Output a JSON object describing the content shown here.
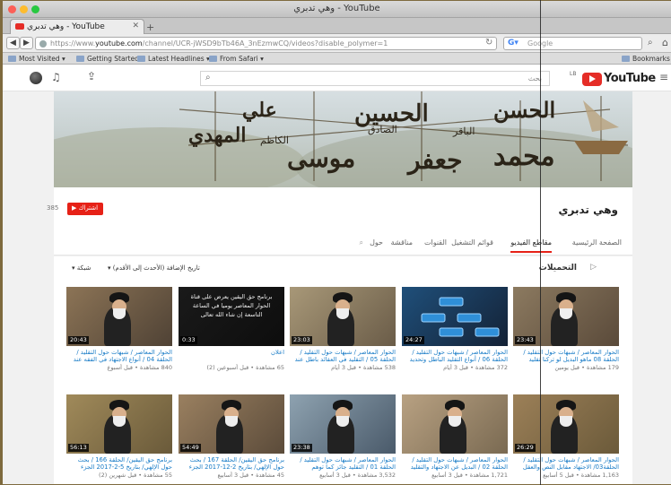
{
  "window": {
    "title": "وهي تدبري - YouTube"
  },
  "tab": {
    "title": "وهي تدبري - YouTube"
  },
  "url": {
    "prefix": "https://www.",
    "domain": "youtube.com",
    "path": "/channel/UCR-jWSD9bTb46A_3nEzmwCQ/videos?disable_polymer=1"
  },
  "search_engine": {
    "placeholder": "Google"
  },
  "bookmarks": {
    "items": [
      "Most Visited",
      "Getting Started",
      "Latest Headlines",
      "From Safari"
    ],
    "right": "Bookmarks"
  },
  "yt": {
    "search_placeholder": "بحث",
    "logo_text": "YouTube",
    "logo_region": "LB"
  },
  "channel": {
    "name": "وهي تدبري",
    "subscribe_label": "اشتراك",
    "subscriber_count": "385"
  },
  "tabs": [
    "الصفحة الرئيسية",
    "مقاطع الفيديو",
    "قوائم التشغيل",
    "القنوات",
    "مناقشة",
    "حول"
  ],
  "uploads": {
    "title": "التحميلات",
    "sort_label": "تاريخ الإضافة (الأحدث إلى الأقدم)",
    "view_label": "شبكة"
  },
  "banner_words": [
    "الحسين",
    "الحسن",
    "الكاظم",
    "موسى",
    "جعفر",
    "الصادق",
    "الباقر",
    "محمد",
    "علي",
    "المهدي"
  ],
  "videos_row1": [
    {
      "duration": "23:43",
      "title": "الحوار المعاصر / شبهات حول التقليد / الحلقة 08 ماهو البديل لو تركنا تقليد",
      "meta": "179 مشاهدة • قبل يومين"
    },
    {
      "duration": "24:27",
      "title": "الحوار المعاصر / شبهات حول التقليد / الحلقة 06 / أنواع التقليد الباطل وتحديد",
      "meta": "372 مشاهدة • قبل 3 أيام"
    },
    {
      "duration": "23:03",
      "title": "الحوار المعاصر / شبهات حول التقليد / الحلقة 05 / التقليد في العقائد باطل عند",
      "meta": "538 مشاهدة • قبل 3 أيام"
    },
    {
      "duration": "0:33",
      "title": "اعلان",
      "meta": "65 مشاهدة • قبل أسبوعين (2)"
    },
    {
      "duration": "20:43",
      "title": "الحوار المعاصر / شبهات حول التقليد / الحلقة 04 / أنواع الاجتهاد في الفقه عند",
      "meta": "840 مشاهدة • قبل أسبوع"
    }
  ],
  "videos_row2": [
    {
      "duration": "26:29",
      "title": "الحوار المعاصر / شبهات حول التقليد / الحلقة03/ الاجتهاد مقابل النص والعقل",
      "meta": "1,163 مشاهدة • قبل 5 أسابيع"
    },
    {
      "duration": "",
      "title": "الحوار المعاصر / شبهات حول التقليد / الحلقة 02 / البديل عن الاجتهاد والتقليد",
      "meta": "1,721 مشاهدة • قبل 3 أسابيع"
    },
    {
      "duration": "23:38",
      "title": "الحوار المعاصر / شبهات حول التقليد / الحلقة 01 / التقليد جائز كما توهم",
      "meta": "3,532 مشاهدة • قبل 3 أسابيع"
    },
    {
      "duration": "54:49",
      "title": "برنامج حق اليقين/ الحلقة 167 / بحث حول الإلهي/ بتاريخ 2-12-2017 الجزء",
      "meta": "45 مشاهدة • قبل 3 أسابيع"
    },
    {
      "duration": "56:13",
      "title": "برنامج حق اليقين/ الحلقة 166 / بحث حول الإلهي/ بتاريخ 5-2-2017 الجزء",
      "meta": "55 مشاهدة • قبل شهرين (2)"
    }
  ],
  "thumb4_text": "برنامج حق اليقين يعرض على قناة الحوار المعاصر يوميا في الساعة التاسعة إن شاء الله تعالى",
  "colors": {
    "brand_red": "#e52d27",
    "link_blue": "#167ac6"
  }
}
